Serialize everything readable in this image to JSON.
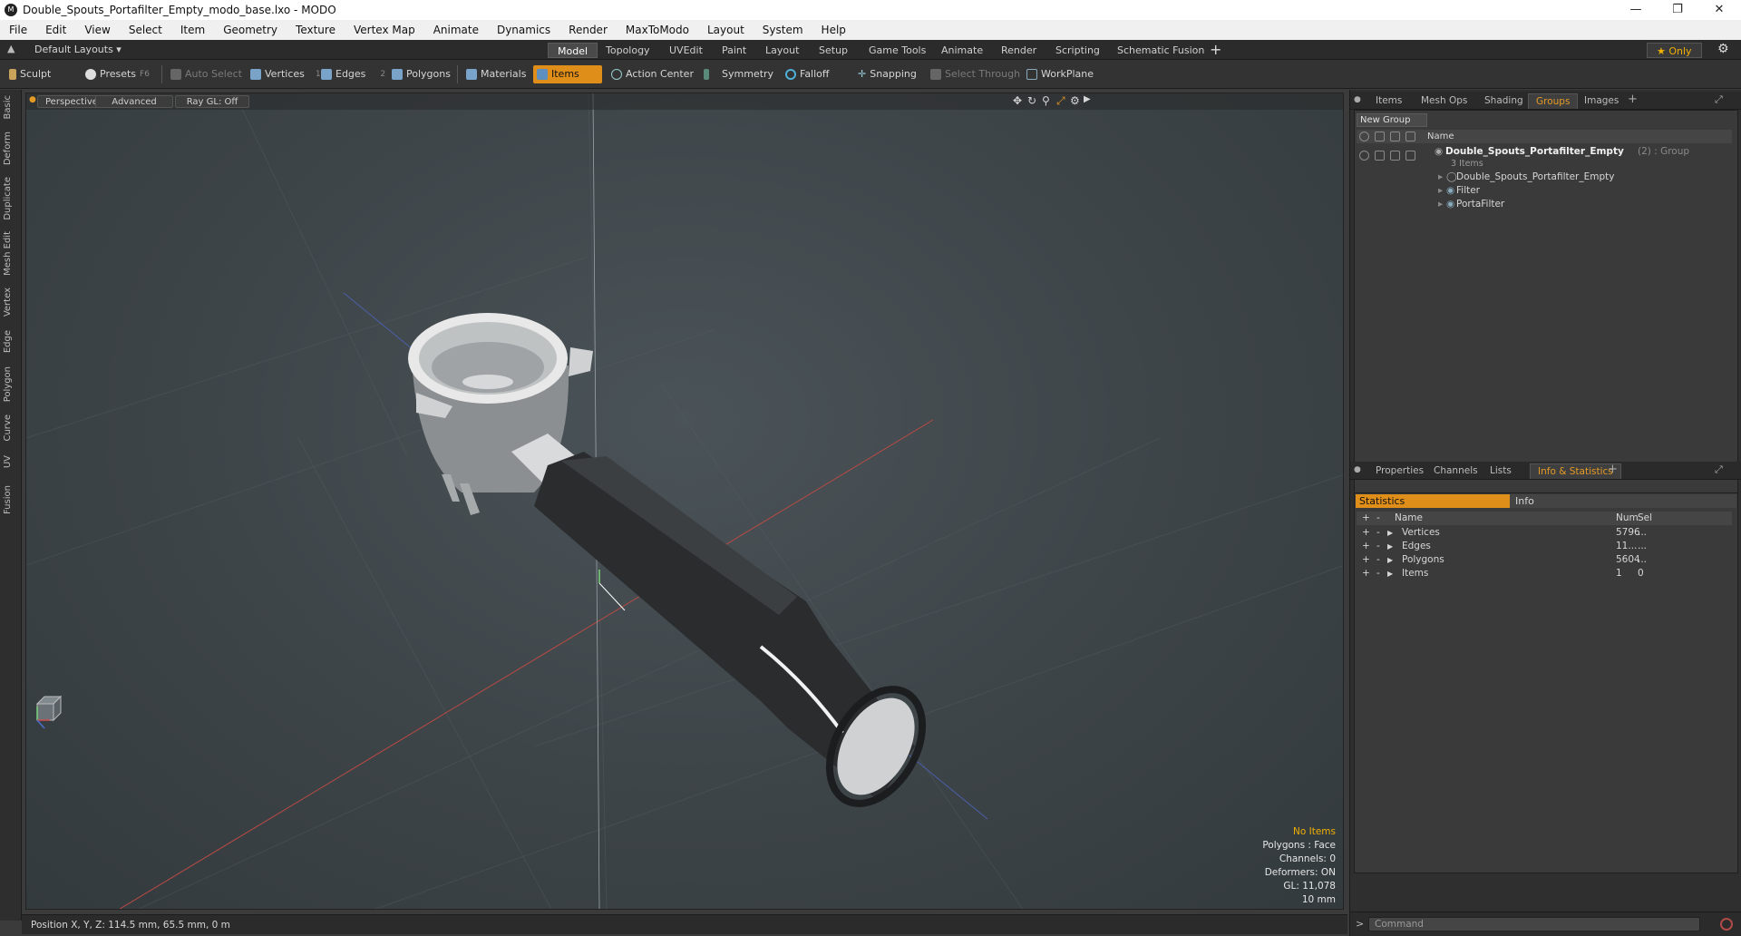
{
  "window": {
    "title": "Double_Spouts_Portafilter_Empty_modo_base.lxo - MODO",
    "app_icon": "modo-logo-icon"
  },
  "menu": [
    "File",
    "Edit",
    "View",
    "Select",
    "Item",
    "Geometry",
    "Texture",
    "Vertex Map",
    "Animate",
    "Dynamics",
    "Render",
    "MaxToModo",
    "Layout",
    "System",
    "Help"
  ],
  "layout_selector": "Default Layouts ▾",
  "mode_tabs": [
    "Model",
    "Topology",
    "UVEdit",
    "Paint",
    "Layout",
    "Setup",
    "Game Tools",
    "Animate",
    "Render",
    "Scripting",
    "Schematic Fusion"
  ],
  "active_mode_tab": "Model",
  "only_button": "★ Only",
  "toolbar": {
    "sculpt": "Sculpt",
    "presets": "Presets",
    "presets_key": "F6",
    "auto_select": "Auto Select",
    "vertices": "Vertices",
    "vertices_count": "1",
    "edges": "Edges",
    "edges_count": "2",
    "polygons": "Polygons",
    "materials": "Materials",
    "items": "Items",
    "action_center": "Action Center",
    "symmetry": "Symmetry",
    "falloff": "Falloff",
    "snapping": "Snapping",
    "select_through": "Select Through",
    "workplane": "WorkPlane"
  },
  "left_tabs": [
    "Basic",
    "Deform",
    "Duplicate",
    "Mesh Edit",
    "Vertex",
    "Edge",
    "Polygon",
    "Curve",
    "UV",
    "Fusion"
  ],
  "viewport": {
    "view": "Perspective",
    "shading": "Advanced",
    "raygl": "Ray GL: Off",
    "hud": {
      "selection": "No Items",
      "polygons": "Polygons : Face",
      "channels": "Channels: 0",
      "deformers": "Deformers: ON",
      "gl": "GL: 11,078",
      "scale": "10 mm"
    }
  },
  "status": "Position X, Y, Z:   114.5 mm, 65.5 mm, 0 m",
  "top_panel": {
    "tabs": [
      "Items",
      "Mesh Ops",
      "Shading",
      "Groups",
      "Images"
    ],
    "active_tab": "Groups",
    "new_group": "New Group",
    "name_header": "Name",
    "group_name": "Double_Spouts_Portafilter_Empty",
    "group_suffix": "(2) : Group",
    "group_count": "3 Items",
    "children": [
      "Double_Spouts_Portafilter_Empty",
      "Filter",
      "PortaFilter"
    ]
  },
  "bottom_panel": {
    "tabs": [
      "Properties",
      "Channels",
      "Lists",
      "Info & Statistics"
    ],
    "active_tab": "Info & Statistics",
    "subtabs": [
      "Statistics",
      "Info"
    ],
    "headers": {
      "name": "Name",
      "num": "Num",
      "sel": "Sel"
    },
    "rows": [
      {
        "name": "Vertices",
        "num": "5796",
        "sel": "..."
      },
      {
        "name": "Edges",
        "num": "11...",
        "sel": "..."
      },
      {
        "name": "Polygons",
        "num": "5604",
        "sel": "..."
      },
      {
        "name": "Items",
        "num": "1",
        "sel": "0"
      }
    ]
  },
  "command": {
    "placeholder": "Command"
  },
  "colors": {
    "accent": "#e08e1a",
    "selection_hud": "#f0b000"
  }
}
